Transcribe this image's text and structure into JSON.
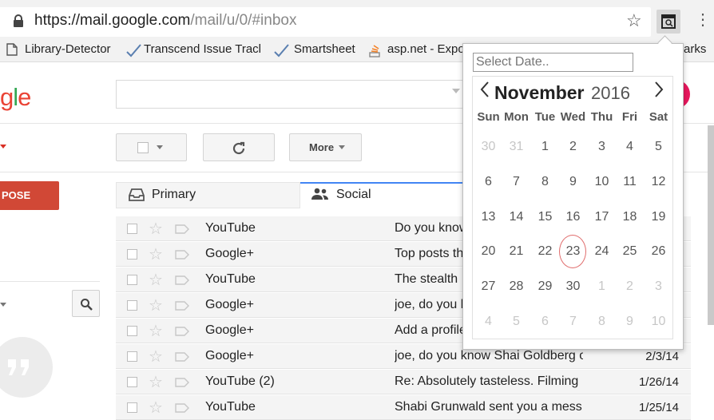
{
  "browser": {
    "url_host": "https://mail.google.com",
    "url_path": "/mail/u/0/#inbox",
    "bookmarks": [
      "Library-Detector",
      "Transcend Issue Tracke",
      "Smartsheet",
      "asp.net - Expo",
      "arks"
    ]
  },
  "gmail": {
    "logo": [
      "g",
      "l",
      "e"
    ],
    "compose_label": "POSE",
    "more_label": "More",
    "tabs": [
      "Primary",
      "Social"
    ],
    "rows": [
      {
        "sender": "YouTube",
        "subject": "Do you know",
        "date": ""
      },
      {
        "sender": "Google+",
        "subject": "Top posts th",
        "date": ""
      },
      {
        "sender": "YouTube",
        "subject": "The stealth",
        "date": ""
      },
      {
        "sender": "Google+",
        "subject": "joe, do you k",
        "date": ""
      },
      {
        "sender": "Google+",
        "subject": "Add a profile",
        "date": ""
      },
      {
        "sender": "Google+",
        "subject": "joe, do you know Shai Goldberg o",
        "date": "2/3/14"
      },
      {
        "sender": "YouTube (2)",
        "subject": "Re: Absolutely tasteless. Filming",
        "date": "1/26/14"
      },
      {
        "sender": "YouTube",
        "subject": "Shabi Grunwald sent you a mess",
        "date": "1/25/14"
      }
    ]
  },
  "popup": {
    "placeholder": "Select Date..",
    "month": "November",
    "year": "2016",
    "weekdays": [
      "Sun",
      "Mon",
      "Tue",
      "Wed",
      "Thu",
      "Fri",
      "Sat"
    ],
    "weeks": [
      [
        "30",
        "31",
        "1",
        "2",
        "3",
        "4",
        "5"
      ],
      [
        "6",
        "7",
        "8",
        "9",
        "10",
        "11",
        "12"
      ],
      [
        "13",
        "14",
        "15",
        "16",
        "17",
        "18",
        "19"
      ],
      [
        "20",
        "21",
        "22",
        "23",
        "24",
        "25",
        "26"
      ],
      [
        "27",
        "28",
        "29",
        "30",
        "1",
        "2",
        "3"
      ],
      [
        "4",
        "5",
        "6",
        "7",
        "8",
        "9",
        "10"
      ]
    ],
    "today": "23"
  }
}
